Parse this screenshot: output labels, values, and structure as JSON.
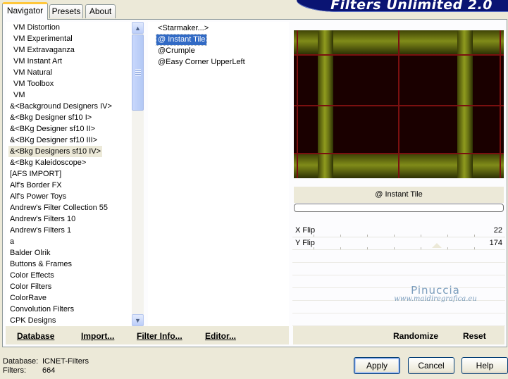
{
  "tabs": [
    {
      "label": "Navigator",
      "active": true
    },
    {
      "label": "Presets",
      "active": false
    },
    {
      "label": "About",
      "active": false
    }
  ],
  "logo": {
    "text": "Filters Unlimited 2.0"
  },
  "categories": [
    {
      "label": "VM Distortion",
      "indented": true
    },
    {
      "label": "VM Experimental",
      "indented": true
    },
    {
      "label": "VM Extravaganza",
      "indented": true
    },
    {
      "label": "VM Instant Art",
      "indented": true
    },
    {
      "label": "VM Natural",
      "indented": true
    },
    {
      "label": "VM Toolbox",
      "indented": true
    },
    {
      "label": "VM",
      "indented": true
    },
    {
      "label": "&<Background Designers IV>",
      "indented": false
    },
    {
      "label": "&<Bkg Designer sf10 I>",
      "indented": false
    },
    {
      "label": "&<BKg Designer sf10 II>",
      "indented": false
    },
    {
      "label": "&<BKg Designer sf10 III>",
      "indented": false
    },
    {
      "label": "&<Bkg Designers sf10 IV>",
      "indented": false,
      "selected": true
    },
    {
      "label": "&<Bkg Kaleidoscope>",
      "indented": false
    },
    {
      "label": "[AFS IMPORT]",
      "indented": false
    },
    {
      "label": "Alf's Border FX",
      "indented": false
    },
    {
      "label": "Alf's Power Toys",
      "indented": false
    },
    {
      "label": "Andrew's Filter Collection 55",
      "indented": false
    },
    {
      "label": "Andrew's Filters 10",
      "indented": false
    },
    {
      "label": "Andrew's Filters 1",
      "indented": false
    },
    {
      "label": "a",
      "indented": false
    },
    {
      "label": "Balder Olrik",
      "indented": false
    },
    {
      "label": "Buttons & Frames",
      "indented": false
    },
    {
      "label": "Color Effects",
      "indented": false
    },
    {
      "label": "Color Filters",
      "indented": false
    },
    {
      "label": "ColorRave",
      "indented": false
    },
    {
      "label": "Convolution Filters",
      "indented": false
    },
    {
      "label": "CPK Designs",
      "indented": false
    }
  ],
  "filters": [
    {
      "label": "<Starmaker...>",
      "selected": false
    },
    {
      "label": "@ Instant Tile",
      "selected": true
    },
    {
      "label": "@Crumple",
      "selected": false
    },
    {
      "label": "@Easy Corner UpperLeft",
      "selected": false
    }
  ],
  "preview": {
    "colors": {
      "background": "#1a0000",
      "band": "#808b19",
      "line": "#7a1010"
    }
  },
  "selected_filter_name": "@ Instant Tile",
  "params": [
    {
      "label": "X Flip",
      "value": "22"
    },
    {
      "label": "Y Flip",
      "value": "174"
    }
  ],
  "watermark": {
    "line1": "Pinuccia",
    "line2": "www.maidiregrafica.eu"
  },
  "toolbar": {
    "database": "Database",
    "import": "Import...",
    "filter_info": "Filter Info...",
    "editor": "Editor...",
    "randomize": "Randomize",
    "reset": "Reset"
  },
  "status": {
    "database_label": "Database:",
    "database_value": "ICNET-Filters",
    "filters_label": "Filters:",
    "filters_value": "664"
  },
  "buttons": {
    "apply": "Apply",
    "cancel": "Cancel",
    "help": "Help"
  }
}
